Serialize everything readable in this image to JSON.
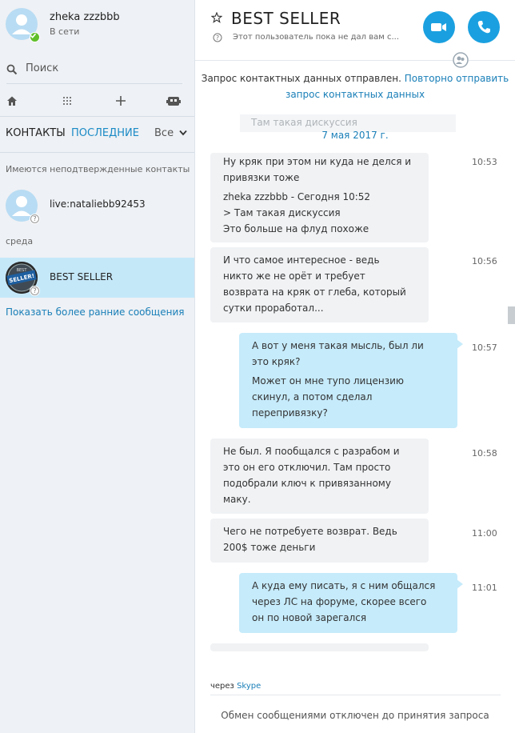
{
  "profile": {
    "name": "zheka zzzbbb",
    "status": "В сети",
    "status_color": "#5fbf2a"
  },
  "search": {
    "placeholder": "Поиск"
  },
  "toolbar": {
    "icons": [
      "home-icon",
      "dialpad-icon",
      "plus-icon",
      "bot-icon"
    ]
  },
  "tabs": {
    "contacts": "КОНТАКТЫ",
    "recent": "ПОСЛЕДНИЕ",
    "filter": "Все"
  },
  "sidebar": {
    "unconfirmed_label": "Имеются неподтвержденные контакты",
    "unconfirmed_contact": "live:nataliebb92453",
    "day_label": "среда",
    "recent_contact": "BEST SELLER",
    "logo_text": "BEST SELLER!",
    "show_earlier": "Показать более ранние сообщения"
  },
  "chat": {
    "title": "BEST SELLER",
    "info": "Этот пользователь пока не дал вам с...",
    "request_text": "Запрос контактных данных отправлен.",
    "resend_link_1": "Повторно отправить",
    "resend_link_2": "запрос контактных данных",
    "ghost_text": "Там такая дискуссия",
    "date": "7 мая 2017 г.",
    "messages": [
      {
        "dir": "in",
        "time": "10:53",
        "lines": [
          "Ну кряк при этом ни куда не делся и",
          "привязки тоже"
        ],
        "quote": [
          "zheka zzzbbb - Сегодня 10:52",
          "> Там такая дискуссия",
          "Это больше на флуд похоже"
        ]
      },
      {
        "dir": "in",
        "time": "10:56",
        "lines": [
          "И что самое интересное - ведь",
          "никто же не орёт и требует",
          "возврата на кряк от глеба, который",
          "сутки проработал..."
        ]
      },
      {
        "dir": "out",
        "time": "10:57",
        "lines": [
          "А вот у меня такая мысль, был ли",
          "это кряк?"
        ],
        "quote": [
          "Может он мне тупо лицензию",
          "скинул, а потом сделал",
          "перепривязку?"
        ]
      },
      {
        "dir": "in",
        "time": "10:58",
        "lines": [
          "Не был. Я пообщался с разрабом и",
          "это он его отключил. Там просто",
          "подобрали ключ к привязанному",
          "маку."
        ]
      },
      {
        "dir": "in",
        "time": "11:00",
        "lines": [
          "Чего не потребуете возврат. Ведь",
          "200$ тоже деньги"
        ]
      },
      {
        "dir": "out",
        "time": "11:01",
        "lines": [
          "А куда ему писать, я с ним общался",
          "через ЛС на форуме, скорее всего",
          "он по новой зарегался"
        ]
      }
    ],
    "via_label": "через",
    "via_link": "Skype",
    "footer_note": "Обмен сообщениями отключен до принятия запроса"
  },
  "colors": {
    "accent": "#1aa0e0",
    "link": "#1a7fb8",
    "selected": "#c5e8f9",
    "outgoing": "#c6ebfb",
    "incoming": "#f0f2f4"
  }
}
